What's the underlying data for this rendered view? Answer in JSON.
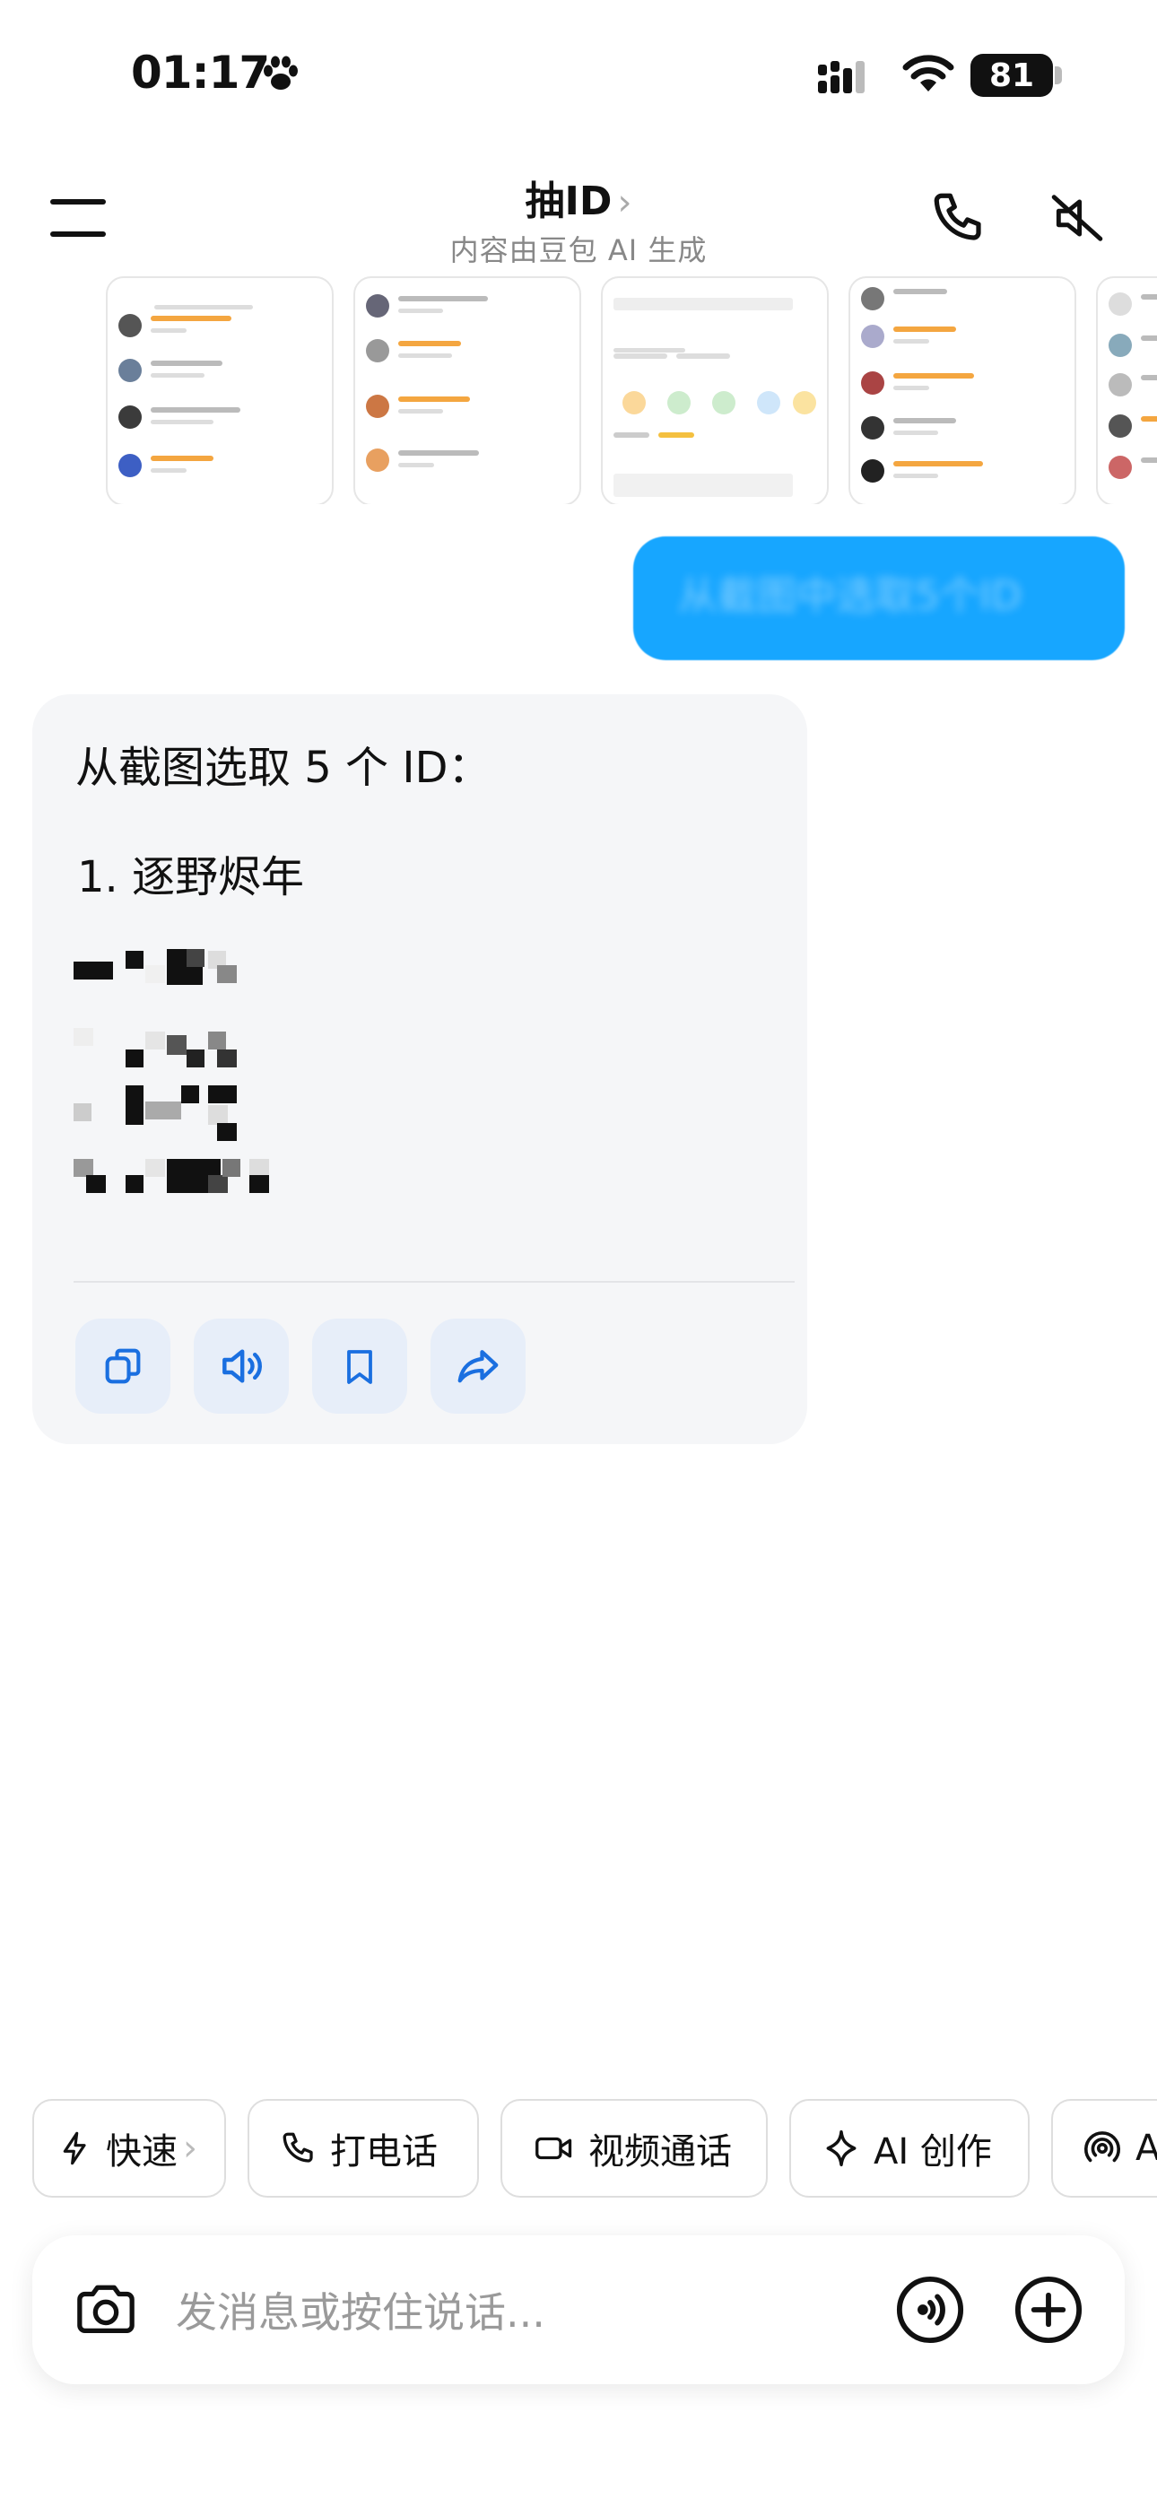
{
  "status_bar": {
    "time": "01:17",
    "battery": "81"
  },
  "header": {
    "title": "抽ID",
    "title_chevron": "›",
    "subtitle": "内容由豆包 AI 生成"
  },
  "user_message": {
    "text": "从截图中选取5个ID",
    "blurred": true
  },
  "assistant": {
    "heading": "从截图选取 5 个 ID：",
    "items": [
      "1. 逐野烬年"
    ],
    "redacted_items": 4
  },
  "actions": [
    {
      "name": "copy-button",
      "icon": "copy-icon"
    },
    {
      "name": "speaker-button",
      "icon": "speaker-icon"
    },
    {
      "name": "bookmark-button",
      "icon": "bookmark-icon"
    },
    {
      "name": "share-button",
      "icon": "share-icon"
    }
  ],
  "quick_actions": [
    {
      "label": "快速",
      "icon": "lightning-icon",
      "suffix": "›"
    },
    {
      "label": "打电话",
      "icon": "phone-icon"
    },
    {
      "label": "视频通话",
      "icon": "video-icon"
    },
    {
      "label": "AI 创作",
      "icon": "sparkle-icon"
    },
    {
      "label": "A",
      "icon": "broadcast-icon"
    }
  ],
  "input": {
    "placeholder": "发消息或按住说话..."
  },
  "colors": {
    "accent": "#17a6ff",
    "icon_blue": "#1a6fe0",
    "card_bg": "#f5f6f8"
  }
}
